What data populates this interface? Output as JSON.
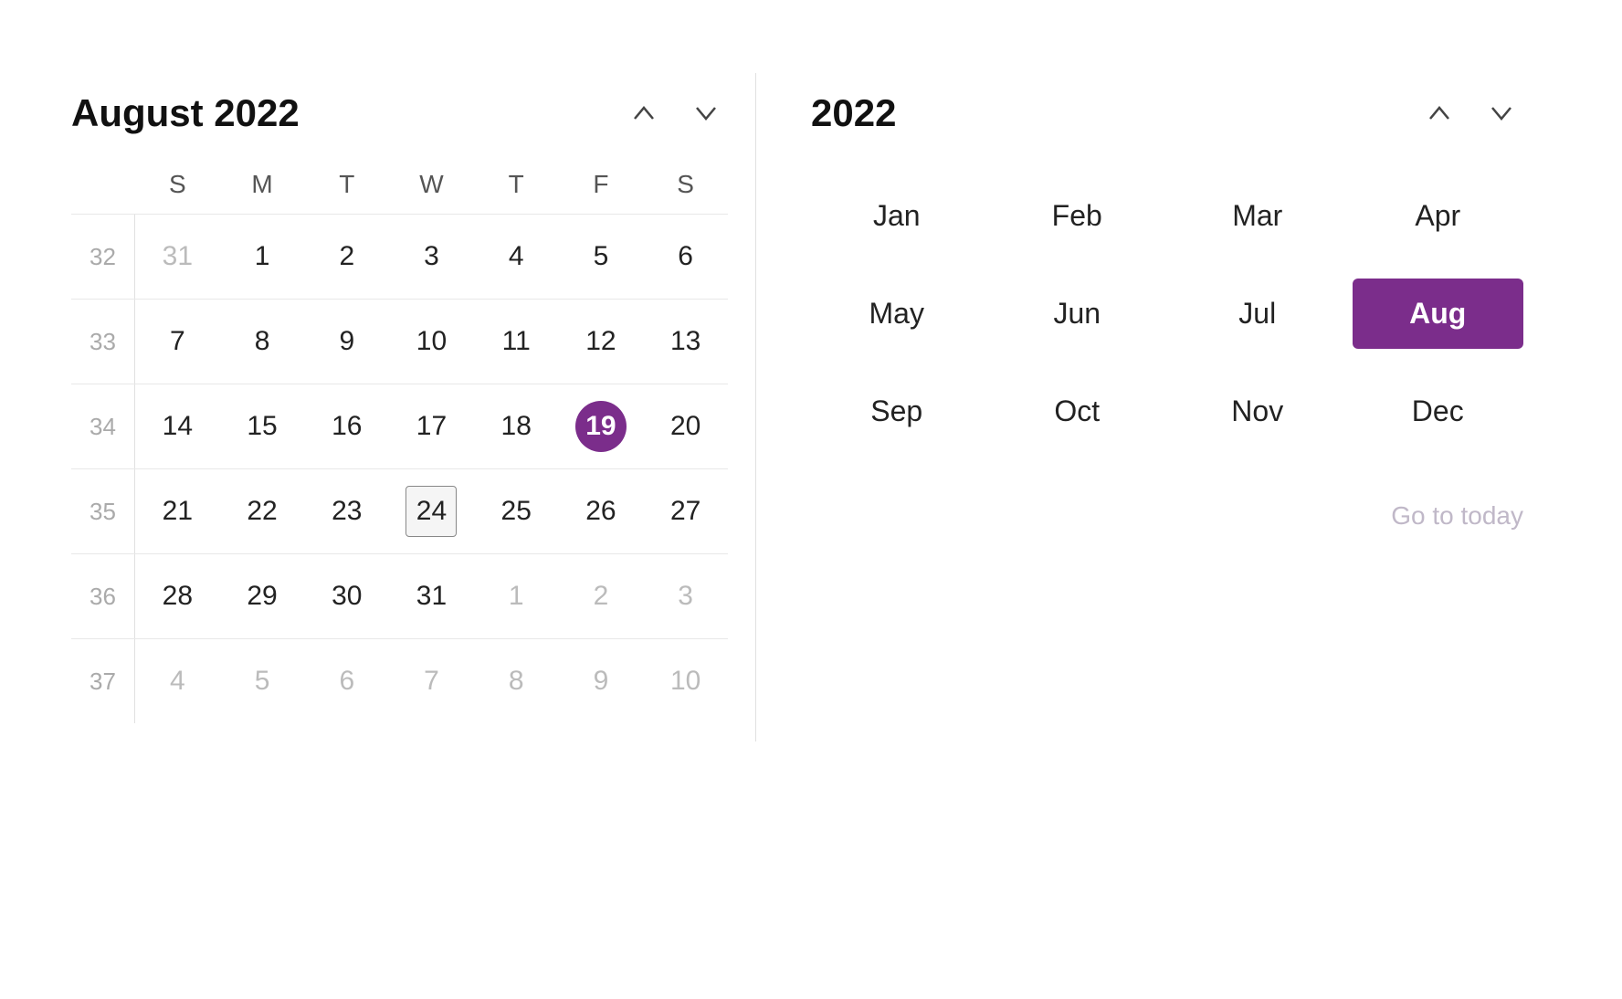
{
  "left": {
    "title": "August 2022",
    "nav": {
      "up_label": "↑",
      "down_label": "↓"
    },
    "day_headers": [
      "S",
      "M",
      "T",
      "W",
      "T",
      "F",
      "S"
    ],
    "weeks": [
      {
        "week_num": "32",
        "days": [
          {
            "label": "31",
            "type": "other-month"
          },
          {
            "label": "1",
            "type": "normal"
          },
          {
            "label": "2",
            "type": "normal"
          },
          {
            "label": "3",
            "type": "normal"
          },
          {
            "label": "4",
            "type": "normal"
          },
          {
            "label": "5",
            "type": "normal"
          },
          {
            "label": "6",
            "type": "normal"
          }
        ]
      },
      {
        "week_num": "33",
        "days": [
          {
            "label": "7",
            "type": "normal"
          },
          {
            "label": "8",
            "type": "normal"
          },
          {
            "label": "9",
            "type": "normal"
          },
          {
            "label": "10",
            "type": "normal"
          },
          {
            "label": "11",
            "type": "normal"
          },
          {
            "label": "12",
            "type": "normal"
          },
          {
            "label": "13",
            "type": "normal"
          }
        ]
      },
      {
        "week_num": "34",
        "days": [
          {
            "label": "14",
            "type": "normal"
          },
          {
            "label": "15",
            "type": "normal"
          },
          {
            "label": "16",
            "type": "normal"
          },
          {
            "label": "17",
            "type": "normal"
          },
          {
            "label": "18",
            "type": "normal"
          },
          {
            "label": "19",
            "type": "today"
          },
          {
            "label": "20",
            "type": "normal"
          }
        ]
      },
      {
        "week_num": "35",
        "days": [
          {
            "label": "21",
            "type": "normal"
          },
          {
            "label": "22",
            "type": "normal"
          },
          {
            "label": "23",
            "type": "normal"
          },
          {
            "label": "24",
            "type": "selected"
          },
          {
            "label": "25",
            "type": "normal"
          },
          {
            "label": "26",
            "type": "normal"
          },
          {
            "label": "27",
            "type": "normal"
          }
        ]
      },
      {
        "week_num": "36",
        "days": [
          {
            "label": "28",
            "type": "normal"
          },
          {
            "label": "29",
            "type": "normal"
          },
          {
            "label": "30",
            "type": "normal"
          },
          {
            "label": "31",
            "type": "normal"
          },
          {
            "label": "1",
            "type": "other-month"
          },
          {
            "label": "2",
            "type": "other-month"
          },
          {
            "label": "3",
            "type": "other-month"
          }
        ]
      },
      {
        "week_num": "37",
        "days": [
          {
            "label": "4",
            "type": "other-month"
          },
          {
            "label": "5",
            "type": "other-month"
          },
          {
            "label": "6",
            "type": "other-month"
          },
          {
            "label": "7",
            "type": "other-month"
          },
          {
            "label": "8",
            "type": "other-month"
          },
          {
            "label": "9",
            "type": "other-month"
          },
          {
            "label": "10",
            "type": "other-month"
          }
        ]
      }
    ]
  },
  "right": {
    "title": "2022",
    "nav": {
      "up_label": "↑",
      "down_label": "↓"
    },
    "months": [
      {
        "label": "Jan",
        "active": false
      },
      {
        "label": "Feb",
        "active": false
      },
      {
        "label": "Mar",
        "active": false
      },
      {
        "label": "Apr",
        "active": false
      },
      {
        "label": "May",
        "active": false
      },
      {
        "label": "Jun",
        "active": false
      },
      {
        "label": "Jul",
        "active": false
      },
      {
        "label": "Aug",
        "active": true
      },
      {
        "label": "Sep",
        "active": false
      },
      {
        "label": "Oct",
        "active": false
      },
      {
        "label": "Nov",
        "active": false
      },
      {
        "label": "Dec",
        "active": false
      }
    ],
    "go_to_today": "Go to today"
  }
}
